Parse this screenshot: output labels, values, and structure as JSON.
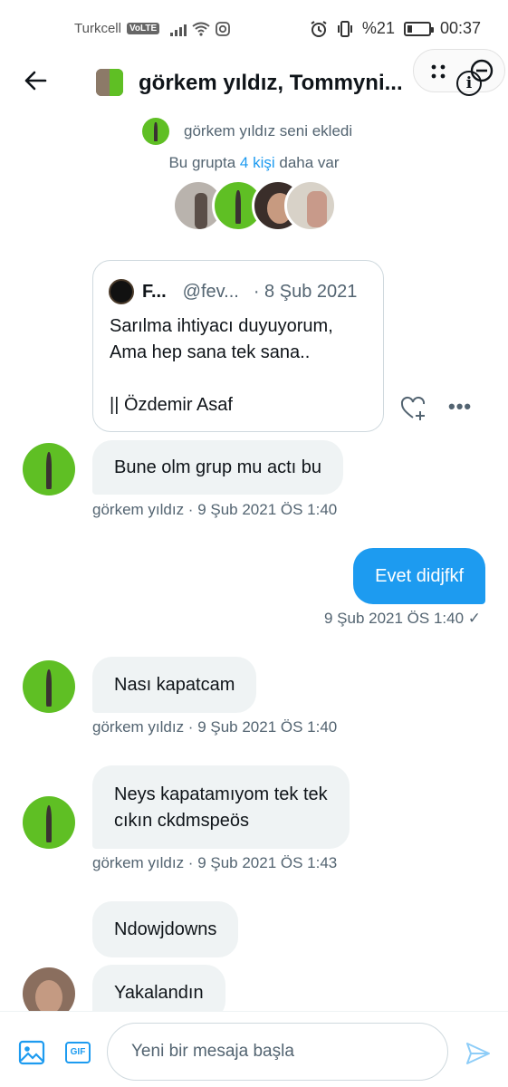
{
  "status_bar": {
    "carrier": "Turkcell",
    "volte": "VoLTE",
    "battery": "%21",
    "time": "00:37"
  },
  "header": {
    "title": "görkem yıldız, Tommyni...",
    "info_icon": "info-icon",
    "back_icon": "arrow-left-icon"
  },
  "group_info": {
    "added_text": "görkem yıldız seni ekledi",
    "count_prefix": "Bu grupta ",
    "count_link": "4 kişi",
    "count_suffix": " daha var"
  },
  "quote_card": {
    "name": "F...",
    "handle": "@fev...",
    "date": "· 8 Şub 2021",
    "text": "Sarılma ihtiyacı duyuyorum,\nAma hep sana tek sana..\n\n|| Özdemir Asaf"
  },
  "messages": [
    {
      "text": "Bune olm grup mu actı bu",
      "meta": "görkem yıldız · 9 Şub 2021 ÖS 1:40"
    },
    {
      "text": "Evet didjfkf",
      "meta": "9 Şub 2021 ÖS 1:40 ✓"
    },
    {
      "text": "Nası kapatcam",
      "meta": "görkem yıldız · 9 Şub 2021 ÖS 1:40"
    },
    {
      "text": "Neys kapatamıyom tek tek\ncıkın ckdmspeös",
      "meta": "görkem yıldız · 9 Şub 2021 ÖS 1:43"
    },
    {
      "text": "Ndowjdowns"
    },
    {
      "text": "Yakalandın"
    }
  ],
  "composer": {
    "placeholder": "Yeni bir mesaja başla",
    "gif_label": "GIF"
  },
  "colors": {
    "accent": "#1d9bf0",
    "bubble_in": "#eff3f4",
    "muted_text": "#536471"
  }
}
